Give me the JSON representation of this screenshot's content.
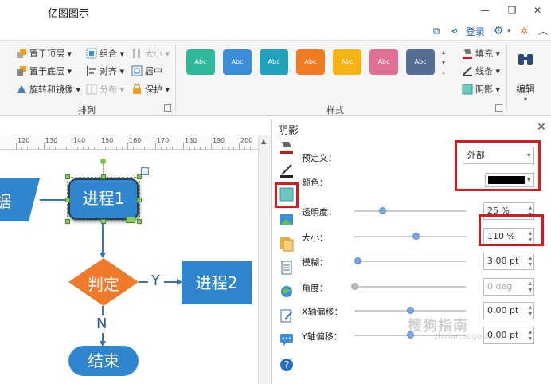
{
  "app": {
    "title": "亿图图示",
    "login": "登录"
  },
  "ribbon": {
    "arrange": {
      "label": "排列",
      "bring_to_front": "置于顶层",
      "send_to_back": "置于底层",
      "rotate_mirror": "旋转和镜像",
      "group": "组合",
      "align": "对齐",
      "distribute": "分布",
      "size": "大小",
      "center": "居中",
      "protect": "保护"
    },
    "style": {
      "label": "样式",
      "swatch_text": "Abc",
      "swatch_colors": [
        "#2fb99a",
        "#3a8fd8",
        "#22a2bc",
        "#f07b23",
        "#f3b414",
        "#df6f93",
        "#566e93"
      ],
      "fill": "填充",
      "line": "线条",
      "shadow": "阴影"
    },
    "edit": {
      "label": "编辑"
    }
  },
  "ruler": {
    "ticks": [
      "120",
      "130",
      "140",
      "150",
      "160",
      "170",
      "180",
      "190",
      "200"
    ]
  },
  "canvas": {
    "shape_data": "据",
    "process1": "进程1",
    "decision": "判定",
    "yes": "Y",
    "process2": "进程2",
    "no": "N",
    "end": "结束",
    "colors": {
      "blue": "#2f86cf",
      "orange": "#ef7a2b",
      "connector": "#3a72b3"
    }
  },
  "panel": {
    "title": "阴影",
    "preset_label": "预定义：",
    "preset_value": "外部",
    "color_label": "颜色：",
    "color_value": "#000000",
    "transparency_label": "透明度：",
    "transparency_value": "25 %",
    "transparency_level": 0.25,
    "size_label": "大小：",
    "size_value": "110 %",
    "size_level": 0.55,
    "blur_label": "模糊：",
    "blur_value": "3.00 pt",
    "blur_level": 0.03,
    "angle_label": "角度：",
    "angle_value": "0 deg",
    "angle_level": 0.0,
    "xoffset_label": "X轴偏移：",
    "xoffset_value": "0.00 pt",
    "xoffset_level": 0.5,
    "yoffset_label": "Y轴偏移：",
    "yoffset_value": "0.00 pt",
    "yoffset_level": 0.5
  },
  "watermark": {
    "text": "搜狗指南",
    "url": "zhinan.sogou.com"
  }
}
